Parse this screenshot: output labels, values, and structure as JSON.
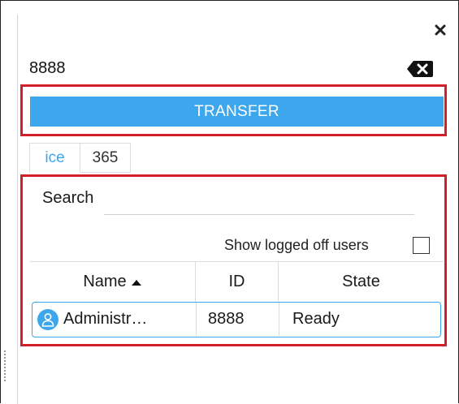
{
  "dialer": {
    "number": "8888"
  },
  "actions": {
    "transfer_label": "TRANSFER"
  },
  "tabs": [
    {
      "label": "ice"
    },
    {
      "label": "365"
    }
  ],
  "search": {
    "label": "Search",
    "value": ""
  },
  "filter": {
    "show_logged_off_label": "Show logged off users",
    "checked": false
  },
  "table": {
    "columns": [
      {
        "label": "Name",
        "sort": "ascending"
      },
      {
        "label": "ID"
      },
      {
        "label": "State"
      }
    ],
    "rows": [
      {
        "name": "Administr…",
        "id": "8888",
        "state": "Ready",
        "icon": "user-icon"
      }
    ]
  },
  "colors": {
    "accent": "#3da7ed",
    "highlight": "#d21f2a"
  },
  "icons": {
    "close": "close-icon",
    "backspace": "backspace-icon",
    "sort": "sort-up-icon",
    "avatar": "user-icon"
  }
}
